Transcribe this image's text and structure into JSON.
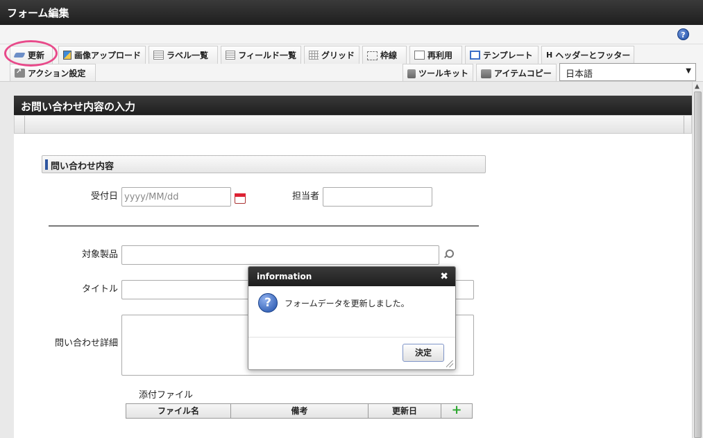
{
  "window": {
    "title": "フォーム編集"
  },
  "toolbar": {
    "update": "更新",
    "image_upload": "画像アップロード",
    "label_list": "ラベル一覧",
    "field_list": "フィールド一覧",
    "grid": "グリッド",
    "frame": "枠線",
    "reuse": "再利用",
    "template": "テンプレート",
    "header_footer": "ヘッダーとフッター",
    "action_settings": "アクション設定",
    "toolkit": "ツールキット",
    "item_copy": "アイテムコピー",
    "language": "日本語"
  },
  "form": {
    "header_title": "お問い合わせ内容の入力",
    "section_title": "問い合わせ内容",
    "fields": {
      "reception_date_label": "受付日",
      "reception_date_placeholder": "yyyy/MM/dd",
      "assignee_label": "担当者",
      "product_label": "対象製品",
      "title_label": "タイトル",
      "detail_label": "問い合わせ詳細",
      "attachment_label": "添付ファイル"
    },
    "attachment_table": {
      "columns": [
        "ファイル名",
        "備考",
        "更新日"
      ]
    }
  },
  "dialog": {
    "title": "information",
    "message": "フォームデータを更新しました。",
    "ok_label": "決定"
  },
  "colors": {
    "accent_dark": "#1e1e1e",
    "highlight_ring": "#e84a8a",
    "section_bar": "#2e56a0"
  }
}
